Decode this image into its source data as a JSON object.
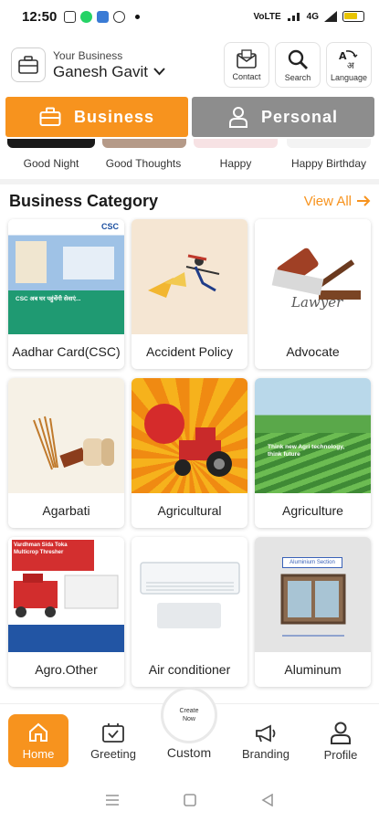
{
  "status_bar": {
    "time": "12:50",
    "network": "VoLTE",
    "signal": "4G"
  },
  "header": {
    "sub_label": "Your Business",
    "business_name": "Ganesh Gavit",
    "buttons": [
      {
        "label": "Contact",
        "icon": "contact-icon"
      },
      {
        "label": "Search",
        "icon": "search-icon"
      },
      {
        "label": "Language",
        "icon": "language-icon"
      }
    ]
  },
  "tabs": [
    {
      "label": "Business",
      "active": true
    },
    {
      "label": "Personal",
      "active": false
    }
  ],
  "greetings": [
    "Good Night",
    "Good Thoughts",
    "Happy",
    "Happy Birthday"
  ],
  "category_section": {
    "title": "Business Category",
    "view_all": "View All"
  },
  "categories": [
    {
      "label": "Aadhar Card(CSC)",
      "banner_text": "CSC अब घर पहुंचेंगी सेवाएं..."
    },
    {
      "label": "Accident Policy",
      "banner_text": ""
    },
    {
      "label": "Advocate",
      "banner_text": "Lawyer"
    },
    {
      "label": "Agarbati",
      "banner_text": ""
    },
    {
      "label": "Agricultural",
      "banner_text": ""
    },
    {
      "label": "Agriculture",
      "banner_text": "Think new Agri technology, think future"
    },
    {
      "label": "Agro.Other",
      "banner_text": "Vardhman Sida Toka Multicrop Thresher"
    },
    {
      "label": "Air conditioner",
      "banner_text": ""
    },
    {
      "label": "Aluminum",
      "banner_text": "Aluminium Section"
    }
  ],
  "bottom_nav": [
    {
      "label": "Home",
      "icon": "home-icon",
      "active": true
    },
    {
      "label": "Greeting",
      "icon": "greeting-icon",
      "active": false
    },
    {
      "label": "Custom",
      "icon": "create-icon",
      "active": false
    },
    {
      "label": "Branding",
      "icon": "megaphone-icon",
      "active": false
    },
    {
      "label": "Profile",
      "icon": "profile-icon",
      "active": false
    }
  ],
  "create_button": {
    "line1": "Create",
    "line2": "Now"
  },
  "colors": {
    "accent": "#f7931e",
    "inactive_tab": "#8d8d8d"
  }
}
